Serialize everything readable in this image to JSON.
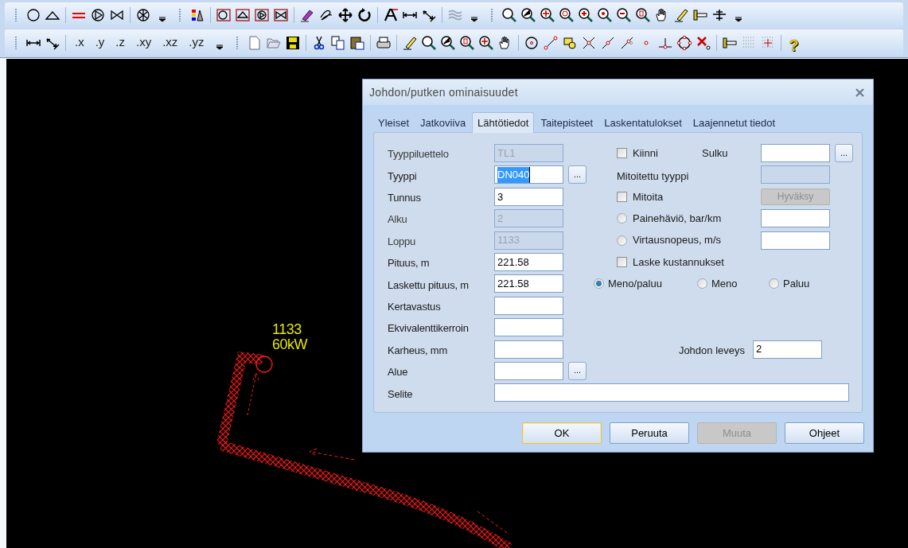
{
  "toolbar": {
    "coordinate_buttons": [
      ".x",
      ".y",
      ".z",
      ".xy",
      ".xz",
      ".yz"
    ],
    "help_button": "?"
  },
  "canvas": {
    "node_labels": [
      "1133",
      "60kW"
    ]
  },
  "dialog": {
    "title": "Johdon/putken ominaisuudet",
    "tabs": [
      {
        "label": "Yleiset",
        "selected": false
      },
      {
        "label": "Jatkoviiva",
        "selected": false
      },
      {
        "label": "Lähtötiedot",
        "selected": true
      },
      {
        "label": "Taitepisteet",
        "selected": false
      },
      {
        "label": "Laskentatulokset",
        "selected": false
      },
      {
        "label": "Laajennetut tiedot",
        "selected": false
      }
    ],
    "rows": [
      {
        "label": "Tyyppiluettelo",
        "value": "TL1",
        "disabled": true,
        "right": {
          "kind": "check_field",
          "label": "Kiinni",
          "checked": false,
          "field_label": "Sulku",
          "browse": "..."
        }
      },
      {
        "label": "Tyyppi",
        "value": "DN040",
        "disabled": false,
        "focused": true,
        "browse": "...",
        "right": {
          "kind": "label_field",
          "label": "Mitoitettu tyyppi",
          "disabled": true
        }
      },
      {
        "label": "Tunnus",
        "value": "3",
        "disabled": false,
        "right": {
          "kind": "check_button",
          "label": "Mitoita",
          "checked": false,
          "button": "Hyväksy",
          "button_disabled": true
        }
      },
      {
        "label": "Alku",
        "value": "2",
        "disabled": true,
        "right": {
          "kind": "radio_field",
          "label": "Painehäviö, bar/km",
          "selected": false
        }
      },
      {
        "label": "Loppu",
        "value": "1133",
        "disabled": true,
        "right": {
          "kind": "radio_field",
          "label": "Virtausnopeus, m/s",
          "selected": false
        }
      },
      {
        "label": "Pituus, m",
        "value": "221.58",
        "disabled": false,
        "right": {
          "kind": "check",
          "label": "Laske kustannukset",
          "checked": false
        }
      },
      {
        "label": "Laskettu pituus, m",
        "value": "221.58",
        "disabled": false,
        "right": {
          "kind": "radio_group",
          "options": [
            {
              "label": "Meno/paluu",
              "selected": true
            },
            {
              "label": "Meno",
              "selected": false
            },
            {
              "label": "Paluu",
              "selected": false
            }
          ]
        }
      },
      {
        "label": "Kertavastus",
        "disabled": false
      },
      {
        "label": "Ekvivalenttikerroin",
        "disabled": false
      },
      {
        "label": "Karheus, mm",
        "disabled": false,
        "right": {
          "kind": "right_label_field",
          "label": "Johdon leveys",
          "value": "2"
        }
      },
      {
        "label": "Alue",
        "disabled": false,
        "browse": "..."
      },
      {
        "label": "Selite",
        "disabled": false,
        "wide": true
      }
    ],
    "buttons": [
      {
        "label": "OK",
        "default": true,
        "disabled": false
      },
      {
        "label": "Peruuta",
        "default": false,
        "disabled": false
      },
      {
        "label": "Muuta",
        "default": false,
        "disabled": true
      },
      {
        "label": "Ohjeet",
        "default": false,
        "disabled": false
      }
    ]
  }
}
